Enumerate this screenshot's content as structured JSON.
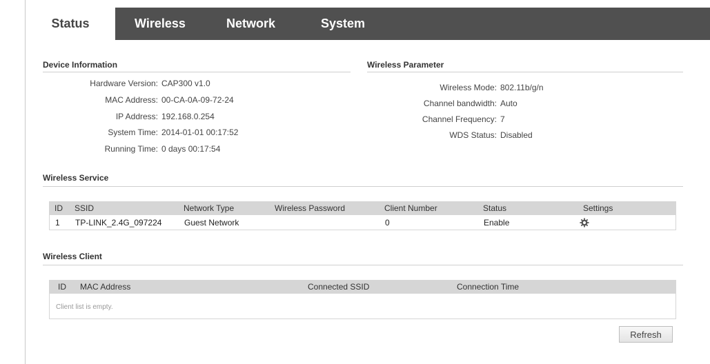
{
  "nav": {
    "tabs": [
      {
        "label": "Status",
        "active": true
      },
      {
        "label": "Wireless",
        "active": false
      },
      {
        "label": "Network",
        "active": false
      },
      {
        "label": "System",
        "active": false
      }
    ]
  },
  "device_info": {
    "title": "Device Information",
    "rows": [
      {
        "label": "Hardware Version:",
        "value": "CAP300 v1.0"
      },
      {
        "label": "MAC Address:",
        "value": "00-CA-0A-09-72-24"
      },
      {
        "label": "IP Address:",
        "value": "192.168.0.254"
      },
      {
        "label": "System Time:",
        "value": "2014-01-01 00:17:52"
      },
      {
        "label": "Running Time:",
        "value": "0 days 00:17:54"
      }
    ]
  },
  "wireless_param": {
    "title": "Wireless Parameter",
    "rows": [
      {
        "label": "Wireless Mode:",
        "value": "802.11b/g/n"
      },
      {
        "label": "Channel bandwidth:",
        "value": "Auto"
      },
      {
        "label": "Channel Frequency:",
        "value": "7"
      },
      {
        "label": "WDS Status:",
        "value": "Disabled"
      }
    ]
  },
  "wireless_service": {
    "title": "Wireless Service",
    "headers": [
      "ID",
      "SSID",
      "Network Type",
      "Wireless Password",
      "Client Number",
      "Status",
      "Settings"
    ],
    "rows": [
      {
        "id": "1",
        "ssid": "TP-LINK_2.4G_097224",
        "network_type": "Guest Network",
        "password": "",
        "client_number": "0",
        "status": "Enable",
        "settings_icon": "gear-icon"
      }
    ]
  },
  "wireless_client": {
    "title": "Wireless Client",
    "headers": [
      "ID",
      "MAC Address",
      "Connected SSID",
      "Connection Time"
    ],
    "empty_message": "Client list is empty."
  },
  "actions": {
    "refresh_label": "Refresh"
  },
  "colors": {
    "nav_bg": "#505050",
    "header_bg": "#d6d6d6"
  }
}
